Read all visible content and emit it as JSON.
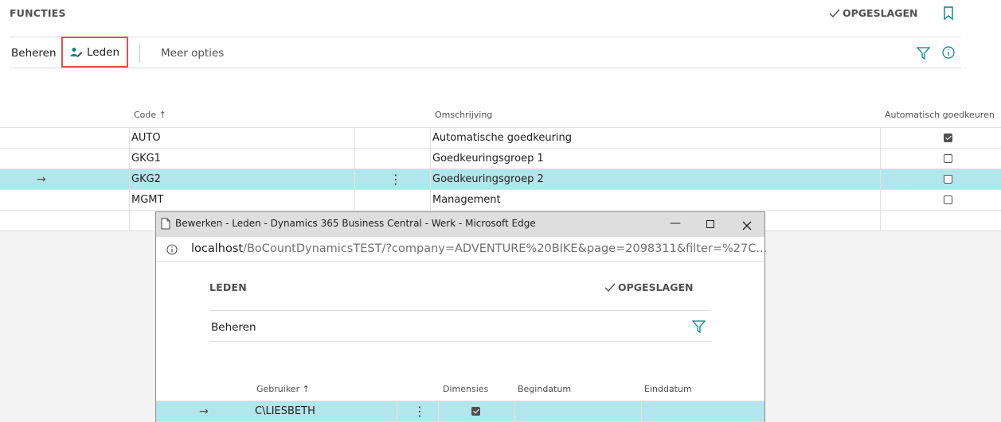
{
  "header": {
    "title": "FUNCTIES",
    "saved_label": "OPGESLAGEN"
  },
  "actions": {
    "manage": "Beheren",
    "members": "Leden",
    "more": "Meer opties"
  },
  "table": {
    "columns": {
      "code": "Code",
      "description": "Omschrijving",
      "auto_approve": "Automatisch goedkeuren"
    },
    "rows": [
      {
        "code": "AUTO",
        "description": "Automatische goedkeuring",
        "auto": true
      },
      {
        "code": "GKG1",
        "description": "Goedkeuringsgroep 1",
        "auto": false
      },
      {
        "code": "GKG2",
        "description": "Goedkeuringsgroep 2",
        "auto": false
      },
      {
        "code": "MGMT",
        "description": "Management",
        "auto": false
      }
    ],
    "selected_index": 2
  },
  "popup": {
    "window_title": "Bewerken - Leden - Dynamics 365 Business Central - Werk - Microsoft Edge",
    "url_host": "localhost",
    "url_rest": "/BoCountDynamicsTEST/?company=ADVENTURE%20BIKE&page=2098311&filter=%27C...",
    "title": "LEDEN",
    "saved_label": "OPGESLAGEN",
    "manage": "Beheren",
    "columns": {
      "user": "Gebruiker",
      "dimensions": "Dimensies",
      "start_date": "Begindatum",
      "end_date": "Einddatum"
    },
    "rows": [
      {
        "user": "C\\LIESBETH",
        "dimensions": true
      }
    ]
  },
  "colors": {
    "accent": "#008489",
    "selected_row": "#b3e6ec",
    "highlight_border": "#d9534f"
  }
}
